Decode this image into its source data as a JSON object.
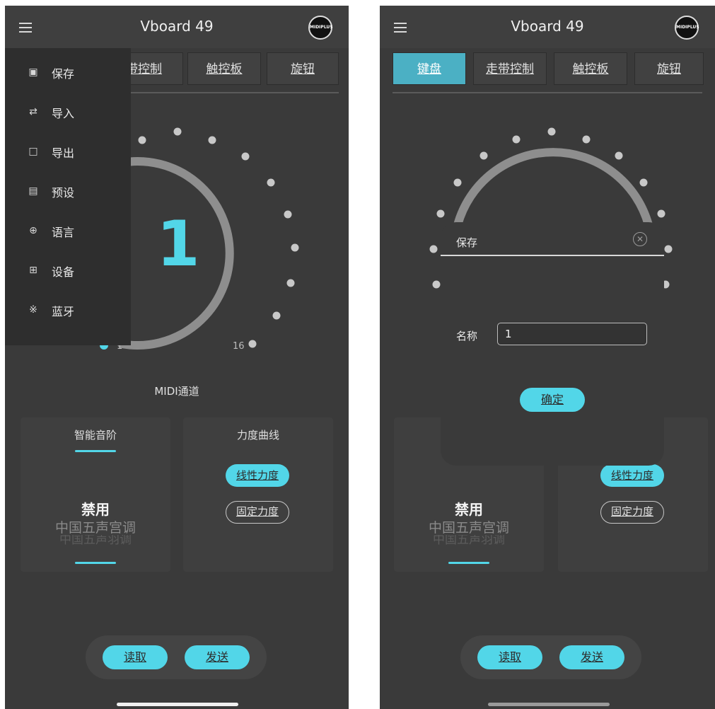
{
  "app_title": "Vboard 49",
  "logo_text": "MIDIPLUS",
  "tabs": [
    "键盘",
    "走带控制",
    "触控板",
    "旋钮"
  ],
  "left_tab_partial": "带控制",
  "dial": {
    "value": "1",
    "min_label": "1",
    "max_label": "16",
    "caption": "MIDI通道"
  },
  "smart_scale": {
    "title": "智能音阶",
    "selected": "禁用",
    "next": "中国五声宫调",
    "next2": "中国五声羽调"
  },
  "velocity_curve": {
    "title": "力度曲线",
    "options": [
      "线性力度",
      "固定力度"
    ],
    "selected_index": 0
  },
  "bottom_buttons": {
    "read": "读取",
    "send": "发送"
  },
  "side_menu": {
    "items": [
      {
        "icon": "save-icon",
        "label": "保存"
      },
      {
        "icon": "import-icon",
        "label": "导入"
      },
      {
        "icon": "folder-icon",
        "label": "导出"
      },
      {
        "icon": "document-icon",
        "label": "预设"
      },
      {
        "icon": "globe-icon",
        "label": "语言"
      },
      {
        "icon": "grid-icon",
        "label": "设备"
      },
      {
        "icon": "bluetooth-icon",
        "label": "蓝牙"
      }
    ]
  },
  "save_dialog": {
    "title": "保存",
    "name_label": "名称",
    "name_value": "1",
    "confirm": "确定"
  },
  "colors": {
    "background": "#3a3a3a",
    "accent": "#52d6e8",
    "tab_active": "#4bb0c4",
    "menu_bg": "#2e2e2e"
  }
}
